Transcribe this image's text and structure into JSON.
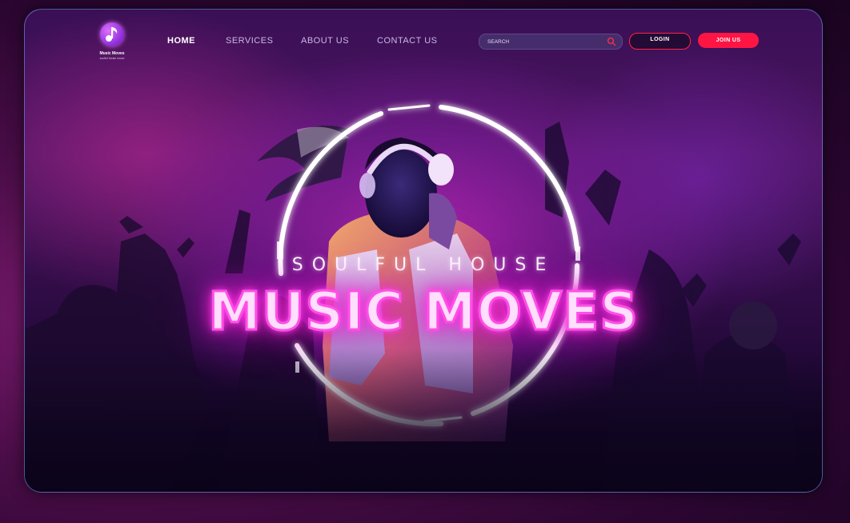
{
  "brand": {
    "name": "Music Moves",
    "tagline": "soulful house music",
    "accent_color": "#ff1544",
    "glow_color": "#ff2bd8"
  },
  "nav": {
    "items": [
      {
        "label": "HOME",
        "active": true
      },
      {
        "label": "SERVICES",
        "active": false
      },
      {
        "label": "ABOUT US",
        "active": false
      },
      {
        "label": "CONTACT US",
        "active": false
      }
    ]
  },
  "search": {
    "placeholder": "SEARCH",
    "icon": "search-icon"
  },
  "auth": {
    "login_label": "LOGIN",
    "join_label": "JOIN US"
  },
  "hero": {
    "subtitle": "SOULFUL HOUSE",
    "headline": "MUSIC MOVES"
  }
}
